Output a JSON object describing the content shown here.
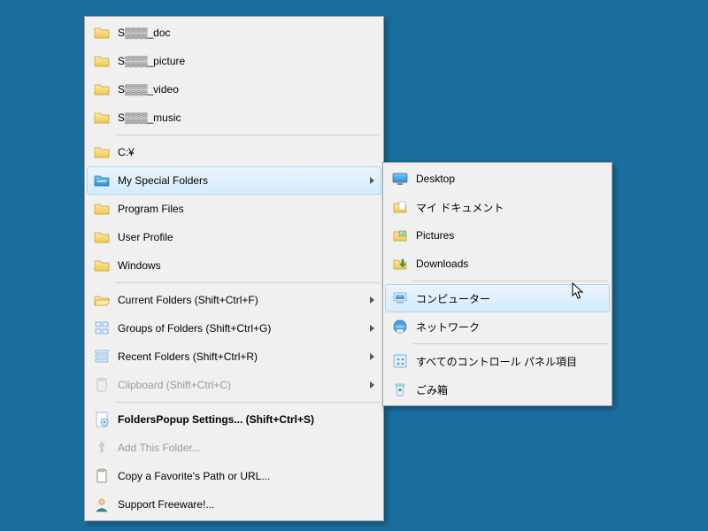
{
  "main_menu": {
    "items": [
      {
        "label": "S▒▒▒_doc",
        "icon": "folder",
        "submenu": false
      },
      {
        "label": "S▒▒▒_picture",
        "icon": "folder",
        "submenu": false
      },
      {
        "label": "S▒▒▒_video",
        "icon": "folder",
        "submenu": false
      },
      {
        "label": "S▒▒▒_music",
        "icon": "folder",
        "submenu": false
      },
      {
        "sep": true
      },
      {
        "label": "C:¥",
        "icon": "folder",
        "submenu": false
      },
      {
        "label": "My Special Folders",
        "icon": "special-folder",
        "submenu": true,
        "highlight": true
      },
      {
        "label": "Program Files",
        "icon": "folder",
        "submenu": false
      },
      {
        "label": "User Profile",
        "icon": "folder",
        "submenu": false
      },
      {
        "label": "Windows",
        "icon": "folder",
        "submenu": false
      },
      {
        "sep": true
      },
      {
        "label": "Current Folders (Shift+Ctrl+F)",
        "icon": "folder-open",
        "submenu": true
      },
      {
        "label": "Groups of Folders (Shift+Ctrl+G)",
        "icon": "groups",
        "submenu": true
      },
      {
        "label": "Recent Folders (Shift+Ctrl+R)",
        "icon": "recent",
        "submenu": true
      },
      {
        "label": "Clipboard (Shift+Ctrl+C)",
        "icon": "clipboard-gray",
        "submenu": true,
        "disabled": true
      },
      {
        "sep": true
      },
      {
        "label": "FoldersPopup Settings... (Shift+Ctrl+S)",
        "icon": "settings-doc",
        "submenu": false,
        "bold": true
      },
      {
        "label": "Add This Folder...",
        "icon": "pin-gray",
        "submenu": false,
        "disabled": true
      },
      {
        "label": "Copy a Favorite's Path or URL...",
        "icon": "clipboard",
        "submenu": false
      },
      {
        "label": "Support Freeware!...",
        "icon": "user",
        "submenu": false
      }
    ]
  },
  "sub_menu": {
    "items": [
      {
        "label": "Desktop",
        "icon": "desktop"
      },
      {
        "label": "マイ ドキュメント",
        "icon": "documents"
      },
      {
        "label": "Pictures",
        "icon": "pictures"
      },
      {
        "label": "Downloads",
        "icon": "downloads"
      },
      {
        "sep": true
      },
      {
        "label": "コンピューター",
        "icon": "computer",
        "highlight": true
      },
      {
        "label": "ネットワーク",
        "icon": "network"
      },
      {
        "sep": true
      },
      {
        "label": "すべてのコントロール パネル項目",
        "icon": "control-panel"
      },
      {
        "label": "ごみ箱",
        "icon": "recycle-bin"
      }
    ]
  }
}
